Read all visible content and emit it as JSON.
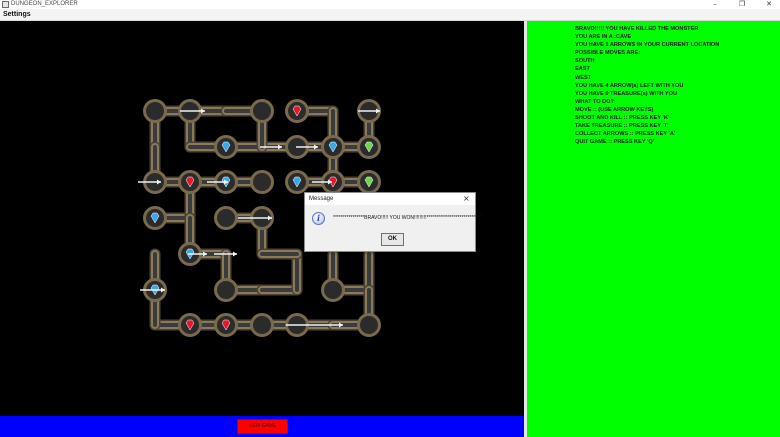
{
  "window": {
    "title": "DUNGEON_EXPLORER",
    "minimize": "–",
    "maximize": "❐",
    "close": "✕"
  },
  "menu": {
    "settings": "Settings"
  },
  "game": {
    "new_game_label": "NEW GAME"
  },
  "colors": {
    "board_bg": "#000000",
    "bottom_bar": "#0000ff",
    "new_game_button": "#ff0000",
    "info_panel": "#00ff00",
    "tube": "#8a7a5c",
    "node": "#2b2b2b"
  },
  "info": {
    "lines": [
      "BRAVO!!!!! YOU HAVE KILLED THE MONSTER",
      "YOU ARE IN A :CAVE",
      "YOU HAVE 1 ARROWS IN YOUR CURRENT LOCATION",
      "POSSIBLE MOVES ARE:",
      "SOUTH",
      "EAST",
      "WEST",
      "YOU HAVE 4 ARROW(s) LEFT WITH YOU",
      "YOU HAVE 0 TREASURE(s) WITH YOU",
      "WHAT TO DO?",
      "MOVE :: (USE ARROW KEYS)",
      "SHOOT AND KILL :: PRESS KEY 'K'",
      "TAKE TREASURE :: PRESS KEY 'T'",
      "COLLECT ARROWS :: PRESS KEY 'A'",
      "QUIT GAME :: PRESS KEY 'Q'"
    ]
  },
  "dialog": {
    "title": "Message",
    "message": "****************BRAVO!!!!! YOU WON!!!!!!!!!*****************************",
    "ok_label": "OK",
    "close": "×",
    "icon_glyph": "i",
    "icon": "information-icon"
  },
  "maze": {
    "items": [
      "ruby",
      "sapphire",
      "emerald",
      "arrow"
    ]
  }
}
